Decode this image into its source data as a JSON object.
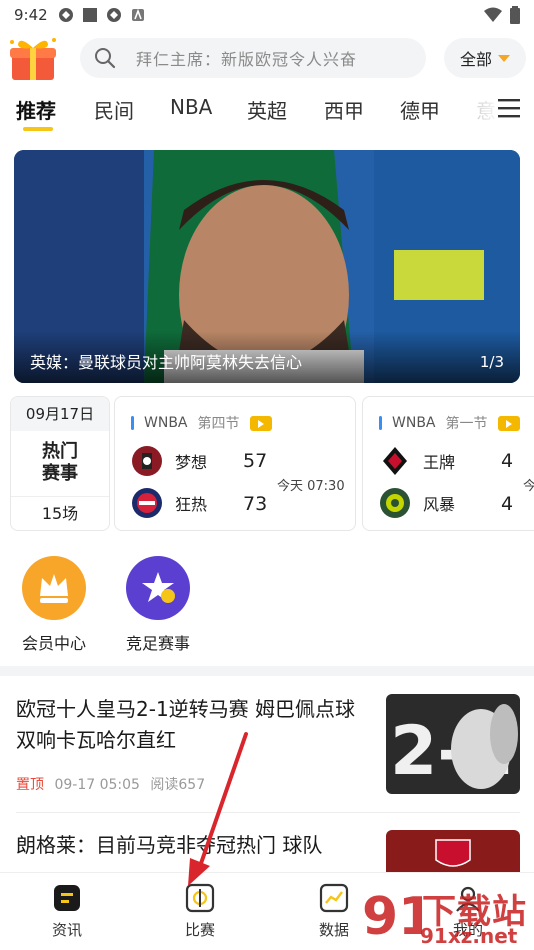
{
  "status_bar": {
    "time": "9:42"
  },
  "search": {
    "placeholder": "拜仁主席：新版欧冠令人兴奋",
    "all_label": "全部"
  },
  "tabs": [
    {
      "label": "推荐"
    },
    {
      "label": "民间"
    },
    {
      "label": "NBA"
    },
    {
      "label": "英超"
    },
    {
      "label": "西甲"
    },
    {
      "label": "德甲"
    },
    {
      "label": "意"
    }
  ],
  "banner": {
    "caption": "英媒：曼联球员对主帅阿莫林失去信心",
    "pager": "1/3"
  },
  "hot_matches": {
    "date": "09月17日",
    "title_line1": "热门",
    "title_line2": "赛事",
    "count": "15场"
  },
  "matches": [
    {
      "league": "WNBA",
      "phase": "第四节",
      "home": "梦想",
      "home_score": "57",
      "away": "狂热",
      "away_score": "73",
      "time": "今天 07:30"
    },
    {
      "league": "WNBA",
      "phase": "第一节",
      "home": "王牌",
      "home_score": "4",
      "away": "风暴",
      "away_score": "4",
      "time": "今"
    }
  ],
  "quick_entries": [
    {
      "label": "会员中心",
      "icon": "crown-icon"
    },
    {
      "label": "竞足赛事",
      "icon": "star-ball-icon"
    }
  ],
  "news": [
    {
      "title": "欧冠十人皇马2-1逆转马赛 姆巴佩点球双响卡瓦哈尔直红",
      "pin": "置顶",
      "date": "09-17 05:05",
      "reads": "阅读657"
    },
    {
      "title": "朗格莱：目前马竞非夺冠热门 球队"
    }
  ],
  "bottom_nav": [
    {
      "label": "资讯",
      "icon": "news-icon"
    },
    {
      "label": "比赛",
      "icon": "match-icon"
    },
    {
      "label": "数据",
      "icon": "chart-icon"
    },
    {
      "label": "我的",
      "icon": "profile-icon"
    }
  ],
  "watermark": {
    "line1": "下载站",
    "line2": "91xz.net"
  },
  "colors": {
    "accent": "#f5c518",
    "pin": "#e84a3a",
    "arrow": "#d9262c"
  }
}
